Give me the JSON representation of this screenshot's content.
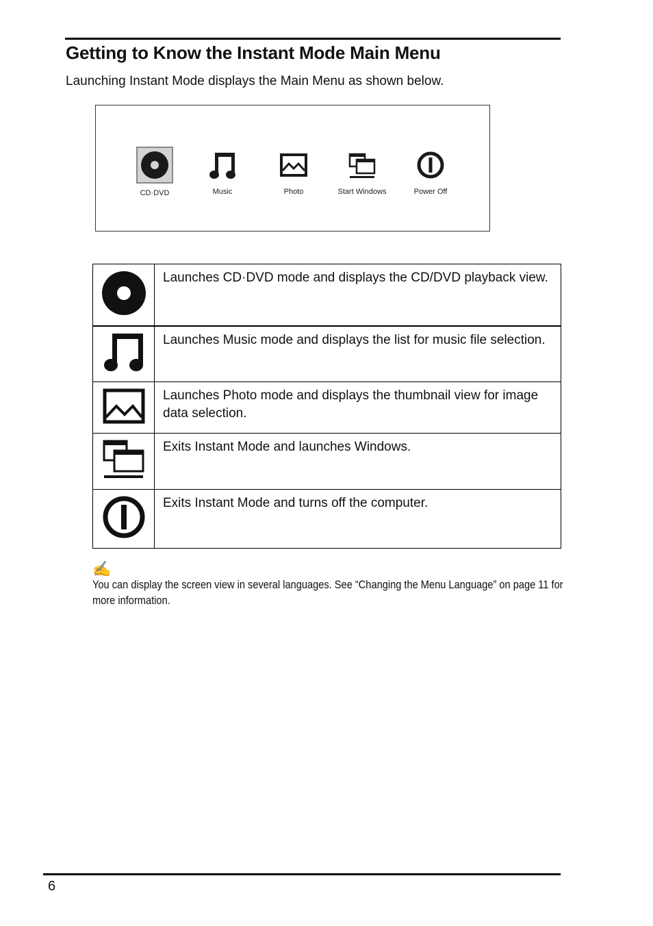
{
  "page": {
    "title": "Getting to Know the Instant Mode Main Menu",
    "intro": "Launching Instant Mode displays the Main Menu as shown below.",
    "page_number": "6"
  },
  "screenshot": {
    "selected_index": 0,
    "items": [
      {
        "label": "CD·DVD",
        "icon": "disc-icon"
      },
      {
        "label": "Music",
        "icon": "music-note-icon"
      },
      {
        "label": "Photo",
        "icon": "photo-icon"
      },
      {
        "label": "Start Windows",
        "icon": "windows-icon"
      },
      {
        "label": "Power Off",
        "icon": "power-icon"
      }
    ]
  },
  "table": {
    "rows": [
      {
        "icon": "disc-icon",
        "text": "Launches CD·DVD mode and displays the CD/DVD playback view."
      },
      {
        "icon": "music-note-icon",
        "text": "Launches Music mode and displays the list for music file selection."
      },
      {
        "icon": "photo-icon",
        "text": "Launches Photo mode and displays the thumbnail view for image data selection."
      },
      {
        "icon": "windows-icon",
        "text": "Exits Instant Mode and launches Windows."
      },
      {
        "icon": "power-icon",
        "text": "Exits Instant Mode and turns off the computer."
      }
    ]
  },
  "note": {
    "icon": "pen-note-icon",
    "text": "You can display the screen view in several languages. See “Changing the Menu Language” on page 11 for more information."
  },
  "colors": {
    "selected_bg": "#d3d3d3",
    "selected_border": "#888888",
    "icon_fill": "#1a1a1a"
  }
}
